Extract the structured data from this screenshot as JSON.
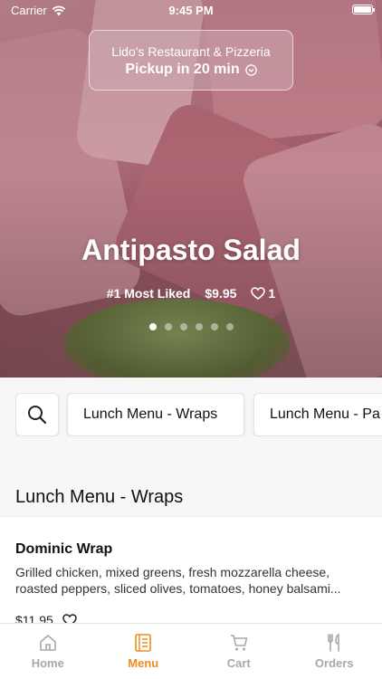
{
  "status_bar": {
    "carrier": "Carrier",
    "time": "9:45 PM"
  },
  "restaurant": {
    "name": "Lido's Restaurant & Pizzeria",
    "pickup": "Pickup in 20 min"
  },
  "featured": {
    "title": "Antipasto Salad",
    "rank": "#1 Most Liked",
    "price": "$9.95",
    "likes": "1",
    "slides_total": 6,
    "slide_active": 1
  },
  "categories": [
    "Lunch Menu - Wraps",
    "Lunch Menu - Pa"
  ],
  "section": {
    "title": "Lunch Menu - Wraps",
    "items": [
      {
        "name": "Dominic Wrap",
        "description": "Grilled chicken, mixed greens, fresh mozzarella cheese, roasted peppers, sliced olives, tomatoes, honey balsami...",
        "price": "$11.95"
      }
    ]
  },
  "tabs": [
    {
      "label": "Home",
      "icon": "home-icon",
      "active": false
    },
    {
      "label": "Menu",
      "icon": "menu-icon",
      "active": true
    },
    {
      "label": "Cart",
      "icon": "cart-icon",
      "active": false
    },
    {
      "label": "Orders",
      "icon": "fork-knife-icon",
      "active": false
    }
  ],
  "colors": {
    "accent": "#f08c1a",
    "inactive_tab": "#a8a8a8"
  }
}
